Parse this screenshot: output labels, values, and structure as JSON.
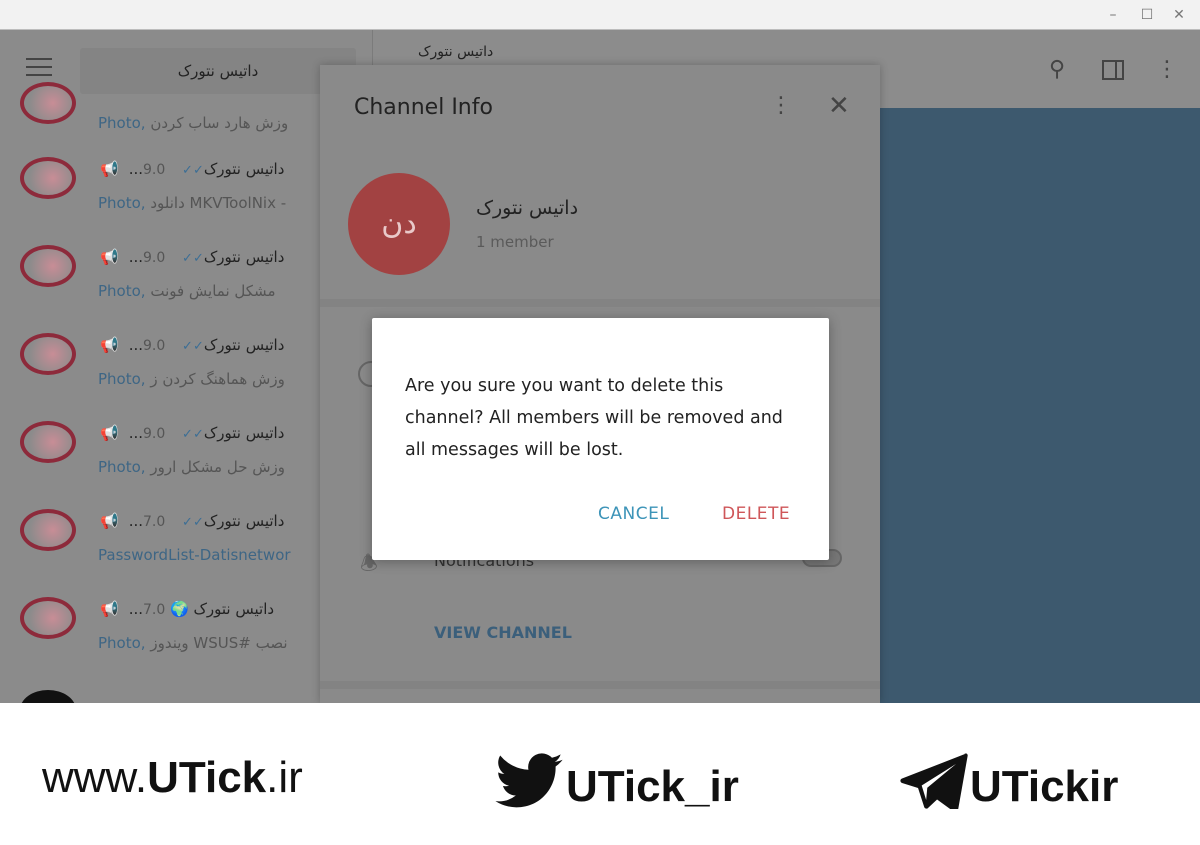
{
  "window": {
    "minimize": "–",
    "maximize": "☐",
    "close": "✕"
  },
  "sidebar": {
    "search_value": "داتیس نتورک",
    "rows": [
      {
        "title": "",
        "time": "",
        "preview_prefix": "Photo,",
        "preview": "وزش هارد ساب کردن",
        "partial": true
      },
      {
        "title": "...داتیس نتورک",
        "time": "9.0",
        "preview_prefix": "Photo,",
        "preview": "دانلود MKVToolNix -"
      },
      {
        "title": "...داتیس نتورک",
        "time": "9.0",
        "preview_prefix": "Photo,",
        "preview": "مشکل نمایش فونت"
      },
      {
        "title": "...داتیس نتورک",
        "time": "9.0",
        "preview_prefix": "Photo,",
        "preview": "وزش هماهنگ کردن ز"
      },
      {
        "title": "...داتیس نتورک",
        "time": "9.0",
        "preview_prefix": "Photo,",
        "preview": "وزش حل مشکل ارور"
      },
      {
        "title": "...داتیس نتورک",
        "time": "7.0",
        "preview_prefix": "",
        "preview": "PasswordList-Datisnetwor"
      },
      {
        "title": "...داتیس نتورک 🌍",
        "time": "7.0",
        "preview_prefix": "Photo,",
        "preview": "ویندوز WSUS# نصب",
        "noticks": true
      }
    ]
  },
  "header": {
    "title": "داتیس نتورک"
  },
  "panel": {
    "title": "Channel Info",
    "channel_initials": "دن",
    "channel_name": "داتیس نتورک",
    "members": "1 member",
    "notifications_label": "Notifications",
    "view_channel": "VIEW CHANNEL"
  },
  "dialog": {
    "message": "Are you sure you want to delete this channel? All members will be removed and all messages will be lost.",
    "cancel": "CANCEL",
    "delete": "DELETE"
  },
  "footer": {
    "website_pre": "www.",
    "website_bold": "UTick",
    "website_post": ".ir",
    "twitter": "UTick_ir",
    "telegram": "UTickir"
  },
  "colors": {
    "chat_bg": "#3d596e",
    "avatar": "#a24242",
    "cancel": "#3d94b8",
    "delete": "#cf5659"
  }
}
